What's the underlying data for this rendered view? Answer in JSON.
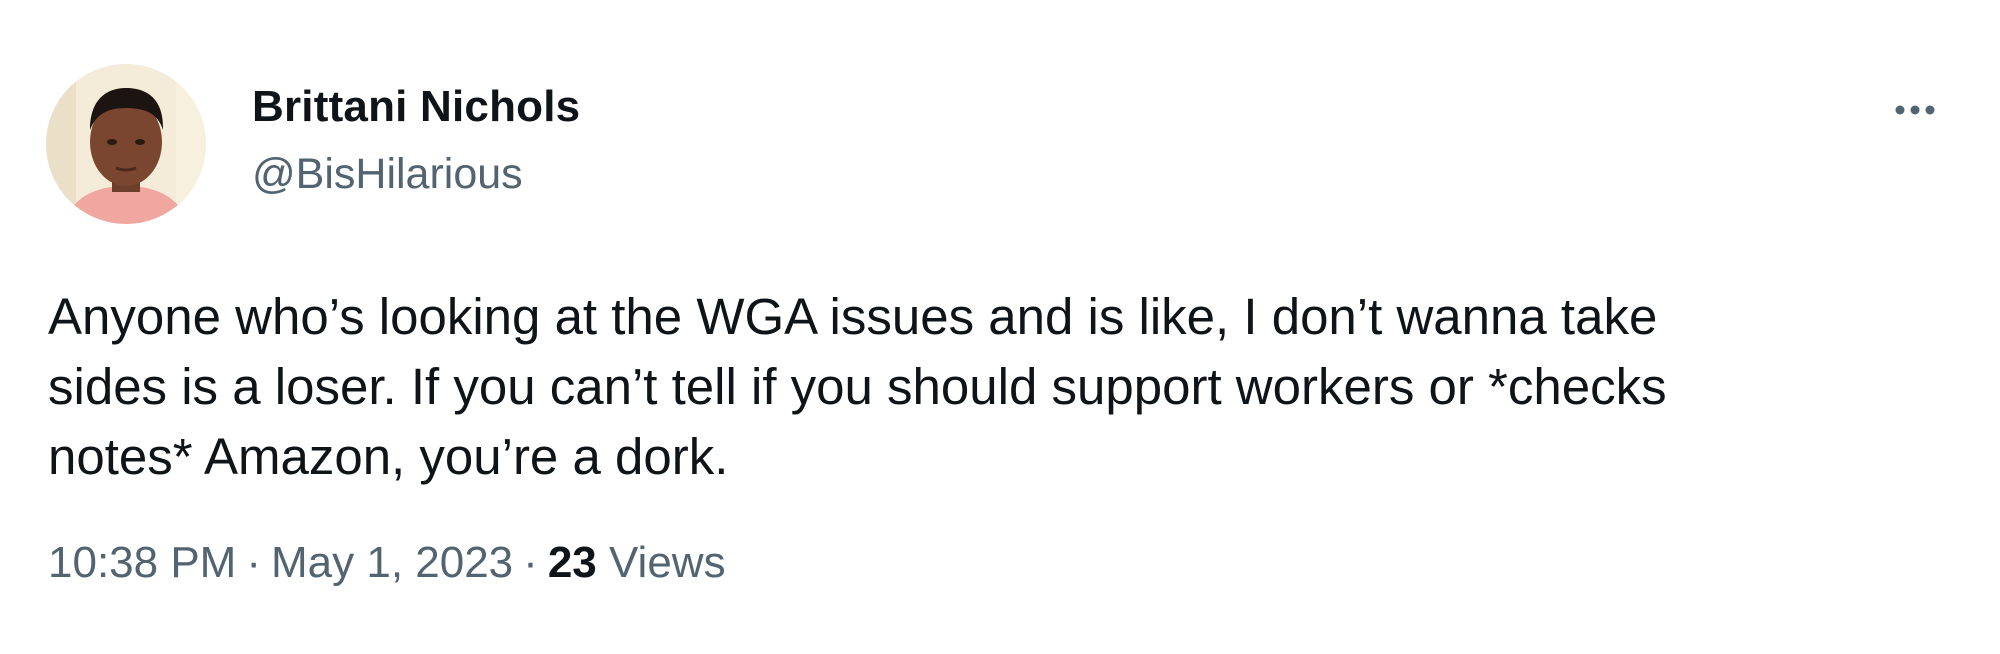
{
  "author": {
    "display_name": "Brittani Nichols",
    "handle": "@BisHilarious",
    "avatar_icon": "profile-photo"
  },
  "more_icon": "more-horizontal-icon",
  "tweet": {
    "lines": [
      "Anyone who’s looking at the WGA issues and is like, I don’t wanna take",
      "sides is a loser. If you can’t tell if you should support workers or *checks",
      "notes* Amazon, you’re a dork."
    ]
  },
  "meta": {
    "time": "10:38 PM",
    "separator": "·",
    "date": "May 1, 2023",
    "views_count": "23",
    "views_label": "Views"
  },
  "colors": {
    "text_primary": "#0f1419",
    "text_secondary": "#536471",
    "background": "#ffffff"
  }
}
